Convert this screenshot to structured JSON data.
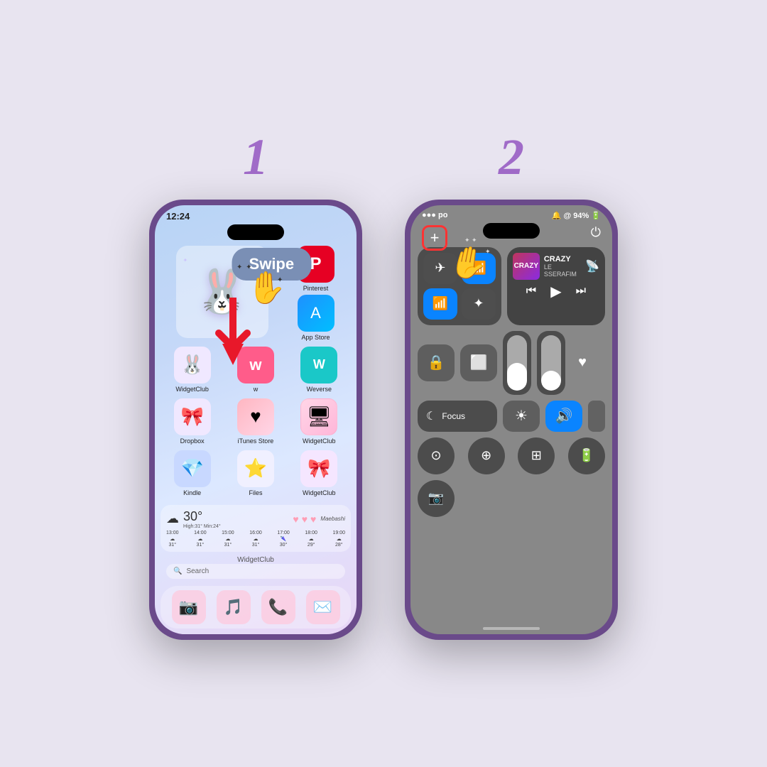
{
  "background_color": "#e8e4f0",
  "step1": {
    "number": "1",
    "swipe_label": "Swipe",
    "phone": {
      "time": "12:24",
      "apps_row1": [
        {
          "label": "Pinterest",
          "icon": "🔴",
          "color": "#e60023"
        },
        {
          "label": "App Store",
          "icon": "🔵",
          "color": "#0d84e8"
        }
      ],
      "apps_row2": [
        {
          "label": "WidgetClub",
          "icon": "🐰",
          "color": "#f5e6ff"
        },
        {
          "label": "W",
          "icon": "W",
          "color": "#ff5c8a"
        },
        {
          "label": "Weverse",
          "icon": "W",
          "color": "#00c8c8"
        }
      ],
      "apps_row3": [
        {
          "label": "Dropbox",
          "icon": "🎀",
          "color": "#f0e8ff"
        },
        {
          "label": "iTunes Store",
          "icon": "♥",
          "color": "#ffb6c1"
        },
        {
          "label": "WidgetClub",
          "icon": "💻",
          "color": "#ffb6d9"
        }
      ],
      "apps_row4": [
        {
          "label": "Kindle",
          "icon": "💎",
          "color": "#c8d8ff"
        },
        {
          "label": "Files",
          "icon": "⭐",
          "color": "#f0f0ff"
        },
        {
          "label": "WidgetClub",
          "icon": "🎀",
          "color": "#f5e6ff"
        }
      ],
      "weather": {
        "temp": "30°",
        "high": "High:31°",
        "min": "Min:24°",
        "city": "Maebashi",
        "hours": [
          "13:00",
          "14:00",
          "15:00",
          "16:00",
          "17:00",
          "18:00",
          "19:00"
        ],
        "temps": [
          "31°",
          "31°",
          "31°",
          "31°",
          "30°",
          "29°",
          "28°"
        ]
      },
      "widgetclub_label": "WidgetClub",
      "search_placeholder": "Search",
      "dock": [
        "📷",
        "🎵",
        "📞",
        "✉️"
      ]
    }
  },
  "step2": {
    "number": "2",
    "phone": {
      "signal": "●●●",
      "carrier": "po",
      "battery": "94%",
      "music": {
        "title": "CRAZY",
        "artist": "LE SSERAFIM",
        "album_text": "CRAZY"
      },
      "connectivity": [
        {
          "icon": "✈",
          "label": "Airplane",
          "active": false
        },
        {
          "icon": "⬛",
          "label": "Cellular",
          "active": true
        },
        {
          "icon": "WiFi",
          "label": "WiFi",
          "active": true
        },
        {
          "icon": "✦",
          "label": "Bluetooth",
          "active": false
        }
      ],
      "tiles": [
        {
          "icon": "🔒",
          "label": "Screen Rotation"
        },
        {
          "icon": "⬜",
          "label": "Mirror"
        },
        {
          "icon": "☾",
          "label": "Focus"
        },
        {
          "icon": "☀",
          "label": "Brightness"
        },
        {
          "icon": "🔊",
          "label": "Volume"
        }
      ],
      "circles": [
        {
          "icon": "⊙",
          "label": "Screen Record"
        },
        {
          "icon": "⊕",
          "label": "Zoom"
        },
        {
          "icon": "⊞",
          "label": "Calculator"
        },
        {
          "icon": "🔋",
          "label": "Battery"
        }
      ],
      "bottom_circle": {
        "icon": "📷",
        "label": "Camera"
      },
      "plus_button": "+",
      "power_icon": "⏻"
    }
  }
}
